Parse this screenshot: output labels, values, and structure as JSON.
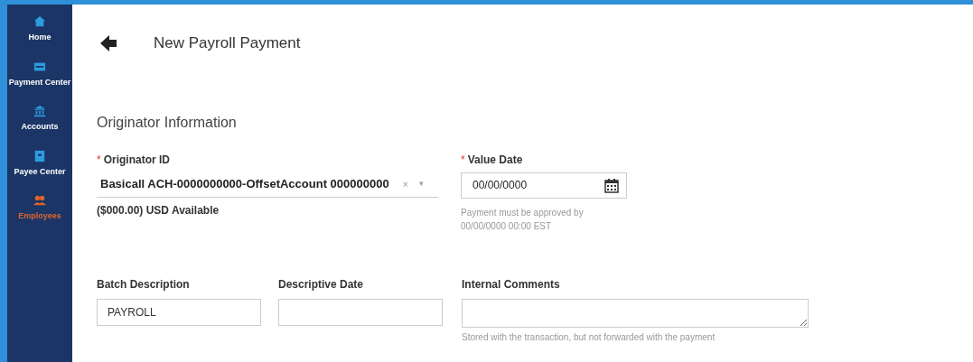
{
  "sidebar": {
    "items": [
      {
        "label": "Home",
        "kind": "home",
        "selected": false
      },
      {
        "label": "Payment Center",
        "kind": "payment",
        "selected": false
      },
      {
        "label": "Accounts",
        "kind": "bank",
        "selected": false
      },
      {
        "label": "Payee Center",
        "kind": "contact",
        "selected": false
      },
      {
        "label": "Employees",
        "kind": "people",
        "selected": true
      }
    ]
  },
  "page_title": "New Payroll Payment",
  "section_title": "Originator Information",
  "originator_id": {
    "label": "Originator ID",
    "required_mark": "*",
    "value": "Basicall ACH-0000000000-OffsetAccount 000000000",
    "clear": "×",
    "caret": "▾",
    "available": "($000.00) USD Available"
  },
  "value_date": {
    "label": "Value Date",
    "required_mark": "*",
    "value": "00/00/0000",
    "hint_lines": [
      "Payment must be approved by",
      "00/00/0000 00:00 EST"
    ]
  },
  "batch_description": {
    "label": "Batch Description",
    "value": "PAYROLL"
  },
  "descriptive_date": {
    "label": "Descriptive Date"
  },
  "internal_comments": {
    "label": "Internal Comments",
    "hint": "Stored with the transaction, but not forwarded with the payment"
  }
}
